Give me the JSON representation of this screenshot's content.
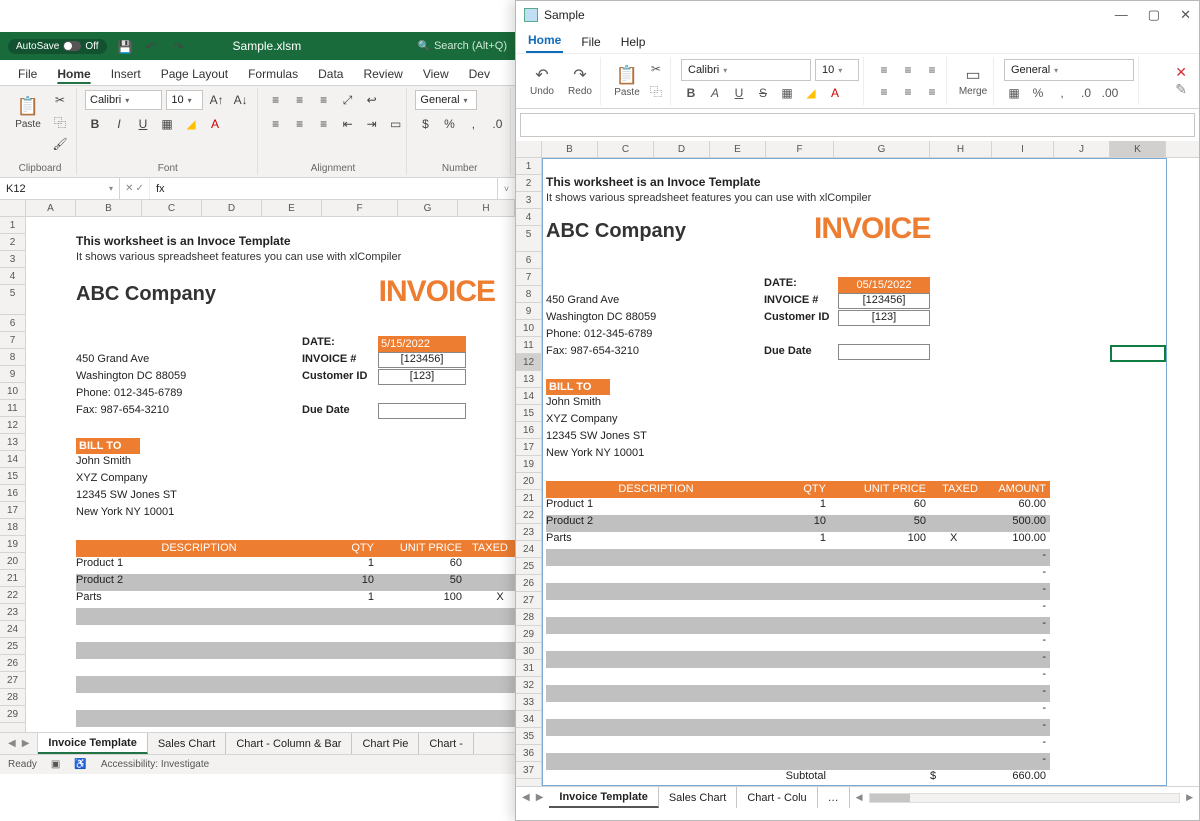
{
  "excel": {
    "autosave": "AutoSave",
    "autosave_state": "Off",
    "filename": "Sample.xlsm",
    "search_placeholder": "Search (Alt+Q)",
    "tabs": [
      "File",
      "Home",
      "Insert",
      "Page Layout",
      "Formulas",
      "Data",
      "Review",
      "View",
      "Dev"
    ],
    "active_tab": "Home",
    "ribbon": {
      "clipboard": "Clipboard",
      "paste": "Paste",
      "font": "Font",
      "font_name": "Calibri",
      "font_size": "10",
      "alignment": "Alignment",
      "number": "Number",
      "number_format": "General"
    },
    "name_box": "K12",
    "sheet_tabs": [
      "Invoice Template",
      "Sales Chart",
      "Chart - Column & Bar",
      "Chart Pie",
      "Chart -"
    ],
    "active_sheet": "Invoice Template",
    "status": {
      "ready": "Ready",
      "accessibility": "Accessibility: Investigate"
    }
  },
  "sample": {
    "title": "Sample",
    "menu": [
      "Home",
      "File",
      "Help"
    ],
    "active_menu": "Home",
    "ribbon": {
      "undo": "Undo",
      "redo": "Redo",
      "paste": "Paste",
      "font_name": "Calibri",
      "font_size": "10",
      "merge": "Merge",
      "number_format": "General"
    },
    "sheet_tabs": [
      "Invoice Template",
      "Sales Chart",
      "Chart - Colu",
      "…"
    ],
    "active_sheet": "Invoice Template"
  },
  "invoice": {
    "heading": "This worksheet is an Invoce Template",
    "subheading": "It shows various spreadsheet features you can use with xlCompiler",
    "company": "ABC Company",
    "invoice_word": "INVOICE",
    "addr1": "450 Grand Ave",
    "addr2": "Washington DC 88059",
    "phone": "Phone: 012-345-6789",
    "fax": "Fax: 987-654-3210",
    "date_lbl": "DATE:",
    "date_excel": "5/15/2022",
    "date_sample": "05/15/2022",
    "invnum_lbl": "INVOICE #",
    "invnum_val": "[123456]",
    "cust_lbl": "Customer ID",
    "cust_val": "[123]",
    "due_lbl": "Due Date",
    "billto": "BILL TO",
    "bill_name": "John Smith",
    "bill_company": "XYZ Company",
    "bill_addr": "12345 SW Jones ST",
    "bill_city": "New York NY 10001",
    "th_desc": "DESCRIPTION",
    "th_qty": "QTY",
    "th_price": "UNIT PRICE",
    "th_taxed": "TAXED",
    "th_amount": "AMOUNT",
    "rows": [
      {
        "desc": "Product 1",
        "qty": "1",
        "price": "60",
        "taxed": "",
        "amount": "60.00"
      },
      {
        "desc": "Product 2",
        "qty": "10",
        "price": "50",
        "taxed": "",
        "amount": "500.00"
      },
      {
        "desc": "Parts",
        "qty": "1",
        "price": "100",
        "taxed": "X",
        "amount": "100.00"
      }
    ],
    "dash": "-",
    "subtotal_lbl": "Subtotal",
    "subtotal_sym": "$",
    "subtotal_val": "660.00"
  },
  "columns": {
    "excel": [
      "A",
      "B",
      "C",
      "D",
      "E",
      "F",
      "G",
      "H"
    ],
    "sample": [
      "B",
      "C",
      "D",
      "E",
      "F",
      "G",
      "H",
      "I",
      "J",
      "K"
    ]
  }
}
